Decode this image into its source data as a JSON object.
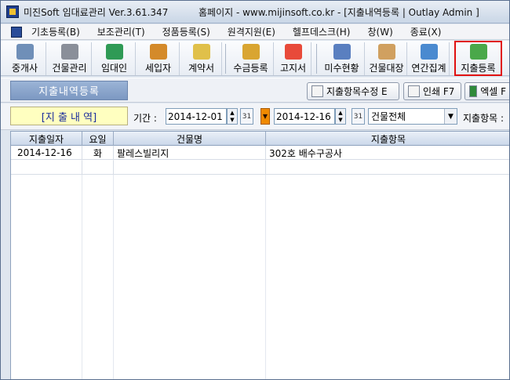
{
  "window": {
    "title_left": "미진Soft 임대료관리 Ver.3.61.347",
    "title_right": "홈페이지 - www.mijinsoft.co.kr - [지출내역등록  |  Outlay Admin ]"
  },
  "menu": {
    "items": [
      "기초등록(B)",
      "보조관리(T)",
      "정품등록(S)",
      "원격지원(E)",
      "헬프데스크(H)",
      "창(W)",
      "종료(X)"
    ]
  },
  "toolbar": {
    "buttons": [
      {
        "label": "중개사",
        "icon": "agent-icon",
        "color": "#6f8fb8"
      },
      {
        "label": "건물관리",
        "icon": "building-icon",
        "color": "#8a8f99"
      },
      {
        "label": "임대인",
        "icon": "landlord-icon",
        "color": "#2f9a55"
      },
      {
        "label": "세입자",
        "icon": "tenant-icon",
        "color": "#d48a2a"
      },
      {
        "label": "계약서",
        "icon": "contract-icon",
        "color": "#e0c04a"
      },
      {
        "label": "수금등록",
        "icon": "coins-icon",
        "color": "#d9a531"
      },
      {
        "label": "고지서",
        "icon": "bill-icon",
        "color": "#e84a3a"
      },
      {
        "label": "미수현황",
        "icon": "receivable-icon",
        "color": "#5a7fc0"
      },
      {
        "label": "건물대장",
        "icon": "ledger-icon",
        "color": "#d0a060"
      },
      {
        "label": "연간집계",
        "icon": "calendar-icon",
        "color": "#4a8ad0"
      },
      {
        "label": "지출등록",
        "icon": "outlay-icon",
        "color": "#4aa84a"
      }
    ]
  },
  "subbar": {
    "section_title": "지출내역등록",
    "edit_button": "지출항목수정 E",
    "print_button": "인쇄 F7",
    "excel_button": "엑셀 F"
  },
  "filter": {
    "panel_label": "[지 출 내 역]",
    "period_label": "기간 :",
    "date_from": "2014-12-01",
    "date_to": "2014-12-16",
    "building_select": "건물전체",
    "item_label": "지출항목 :"
  },
  "grid": {
    "columns": [
      "지출일자",
      "요일",
      "건물명",
      "지출항목"
    ],
    "rows": [
      {
        "date": "2014-12-16",
        "day": "화",
        "building": "팔레스빌리지",
        "item": "302호 배수구공사"
      }
    ]
  }
}
